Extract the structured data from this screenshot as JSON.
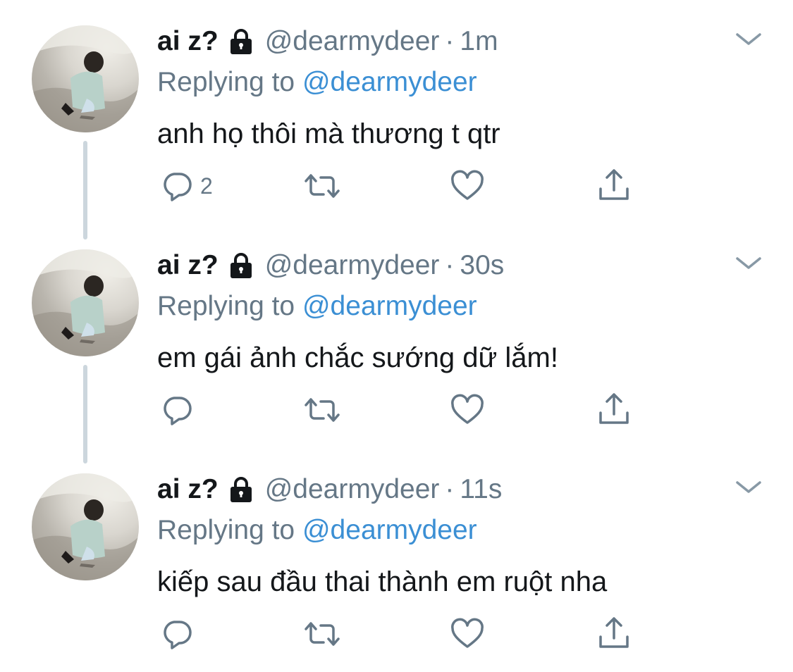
{
  "icons": {
    "lock": "lock-icon",
    "caret": "chevron-down-icon",
    "reply": "reply-icon",
    "retweet": "retweet-icon",
    "like": "heart-icon",
    "share": "share-icon"
  },
  "colors": {
    "text": "#14171a",
    "secondary": "#657786",
    "mention": "#3b8fd4",
    "connector": "#ccd6dd"
  },
  "tweets": [
    {
      "name": "ai z?",
      "handle": "@dearmydeer",
      "separator": "·",
      "time": "1m",
      "replying_label": "Replying to",
      "replying_to": "@dearmydeer",
      "text": "anh họ thôi mà thương t qtr",
      "reply_count": "2"
    },
    {
      "name": "ai z?",
      "handle": "@dearmydeer",
      "separator": "·",
      "time": "30s",
      "replying_label": "Replying to",
      "replying_to": "@dearmydeer",
      "text": "em gái ảnh chắc sướng dữ lắm!",
      "reply_count": ""
    },
    {
      "name": "ai z?",
      "handle": "@dearmydeer",
      "separator": "·",
      "time": "11s",
      "replying_label": "Replying to",
      "replying_to": "@dearmydeer",
      "text": "kiếp sau đầu thai thành em ruột nha",
      "reply_count": ""
    }
  ]
}
